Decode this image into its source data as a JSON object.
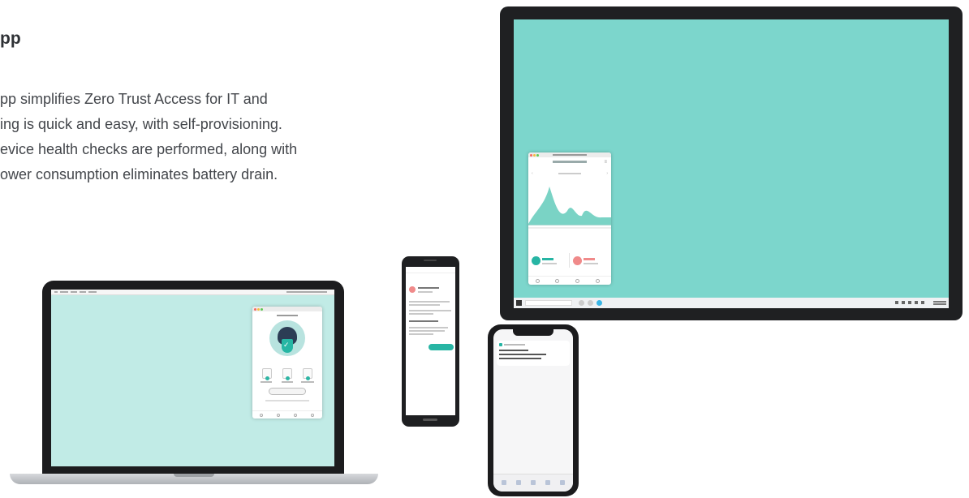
{
  "section": {
    "heading": "pp",
    "body_lines": [
      "pp simplifies Zero Trust Access for IT and",
      "ing is quick and easy, with self-provisioning.",
      "evice health checks are performed, along with",
      "ower consumption eliminates battery drain."
    ]
  },
  "devices": {
    "laptop": {
      "screen_color": "#c1ebe6",
      "app_avatar_icon": "ninja-shield-icon"
    },
    "android_phone": {
      "accent_color": "#27b5a4",
      "alert_color": "#f08a8a"
    },
    "iphone": {
      "notification_icon": "app-notification-icon"
    },
    "monitor": {
      "screen_color": "#7cd6cc",
      "app_chart_color": "#7ad3c5",
      "stat_colors": [
        "#27b5a4",
        "#f08a8a"
      ]
    }
  }
}
